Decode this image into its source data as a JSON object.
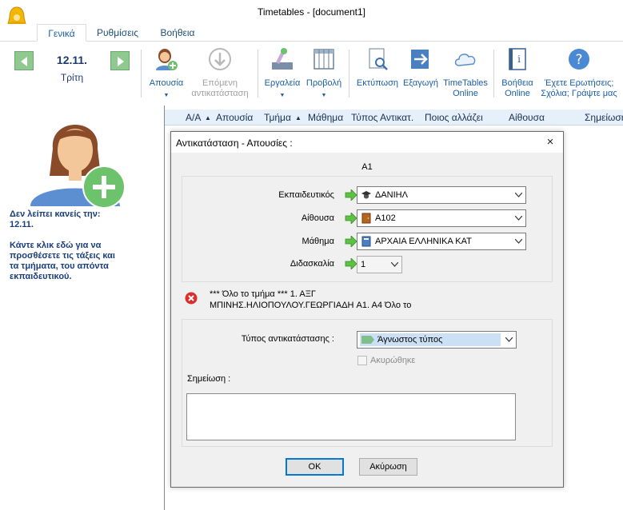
{
  "window": {
    "title": "Timetables - [document1]"
  },
  "tabs": [
    {
      "label": "Γενικά"
    },
    {
      "label": "Ρυθμίσεις"
    },
    {
      "label": "Βοήθεια"
    }
  ],
  "ribbon": {
    "date": "12.11.",
    "day": "Τρίτη",
    "absence": {
      "label": "Απουσία"
    },
    "next_sub": {
      "line1": "Επόμενη",
      "line2": "αντικατάσταση"
    },
    "tools": {
      "label": "Εργαλεία"
    },
    "view": {
      "label": "Προβολή"
    },
    "print": {
      "label": "Εκτύπωση"
    },
    "export": {
      "label": "Εξαγωγή"
    },
    "online": {
      "line1": "TimeTables",
      "line2": "Online"
    },
    "help_online": {
      "line1": "Βοήθεια",
      "line2": "Online"
    },
    "faq": {
      "line1": "Έχετε Ερωτήσεις;",
      "line2": "Σχόλια; Γράψτε μας"
    }
  },
  "left_panel": {
    "line1": "Δεν λείπει κανείς την:",
    "line2": "12.11.",
    "line3": "Κάντε κλικ εδώ για να",
    "line4": "προσθέσετε τις τάξεις και",
    "line5": "τα τμήματα, του απόντα",
    "line6": "εκπαιδευτικού."
  },
  "table": {
    "columns": [
      "Α/Α",
      "Απουσία",
      "Τμήμα",
      "Μάθημα",
      "Τύπος Αντικατ.",
      "Ποιος αλλάζει",
      "Αίθουσα",
      "Σημείωση"
    ]
  },
  "dialog": {
    "title": "Αντικατάσταση - Απουσίες :",
    "close_icon": "×",
    "class_label": "A1",
    "teacher_label": "Εκπαιδευτικός",
    "teacher_value": "ΔΑΝΙΗΛ",
    "room_label": "Αίθουσα",
    "room_value": "A102",
    "subject_label": "Μάθημα",
    "subject_value": "ΑΡΧΑΙΑ ΕΛΛΗΝΙΚΑ ΚΑΤ",
    "lesson_label": "Διδασκαλία",
    "lesson_value": "1",
    "error_line1": "*** Όλο το τμήμα *** 1. ΑΞΓ",
    "error_line2": "ΜΠΙΝΗΣ.ΗΛΙΟΠΟΥΛΟΥ.ΓΕΩΡΓΙΑΔΗ A1. A4 Όλο το",
    "sub_type_label": "Τύπος αντικατάστασης :",
    "sub_type_value": "Άγνωστος τύπος",
    "cancelled_label": "Ακυρώθηκε",
    "note_label": "Σημείωση :",
    "note_value": "",
    "ok_label": "OK",
    "cancel_label": "Ακύρωση"
  },
  "colors": {
    "accent": "#1b5fa8",
    "nav_green": "#8fc98f",
    "error_red": "#d9302f",
    "arrow_green": "#5cc243",
    "sub_type_highlight": "#cce0f5",
    "sub_type_swatch": "#7fbf8a"
  }
}
